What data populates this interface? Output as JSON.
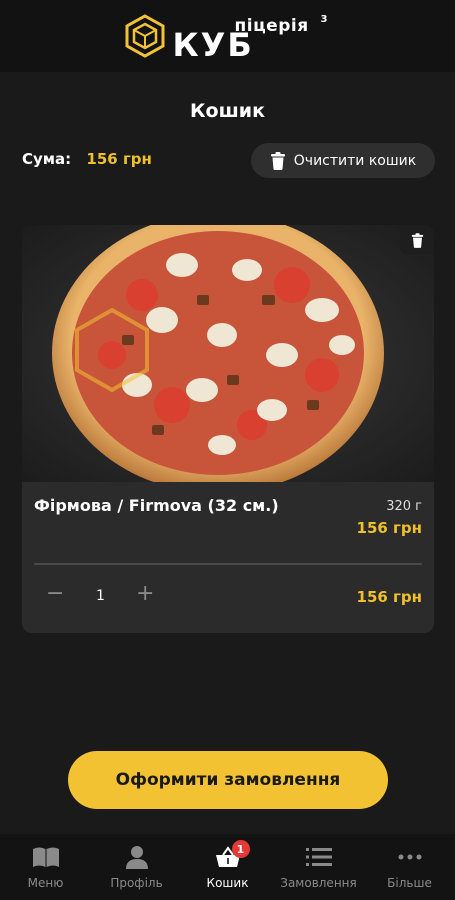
{
  "brand": {
    "top": "піцерія",
    "sup": "3",
    "main": "КУБ"
  },
  "page": {
    "title": "Кошик"
  },
  "summary": {
    "label": "Сума:",
    "value": "156 грн"
  },
  "clear_button": {
    "label": "Очистити кошик",
    "icon": "trash-icon"
  },
  "cart": {
    "items": [
      {
        "name": "Фірмова / Firmova (32 см.)",
        "weight": "320 г",
        "price": "156 грн",
        "quantity": "1",
        "minus": "−",
        "plus": "+",
        "total": "156 грн"
      }
    ]
  },
  "checkout": {
    "label": "Оформити замовлення"
  },
  "tabbar": {
    "items": [
      {
        "label": "Меню",
        "icon": "book-icon"
      },
      {
        "label": "Профіль",
        "icon": "user-icon"
      },
      {
        "label": "Кошик",
        "icon": "basket-icon",
        "badge": "1",
        "active": true
      },
      {
        "label": "Замовлення",
        "icon": "list-icon"
      },
      {
        "label": "Більше",
        "icon": "more-icon"
      }
    ]
  },
  "colors": {
    "accent": "#f2c232",
    "background": "#1a1a1a",
    "card": "#2b2b2b",
    "badge": "#e53935"
  }
}
